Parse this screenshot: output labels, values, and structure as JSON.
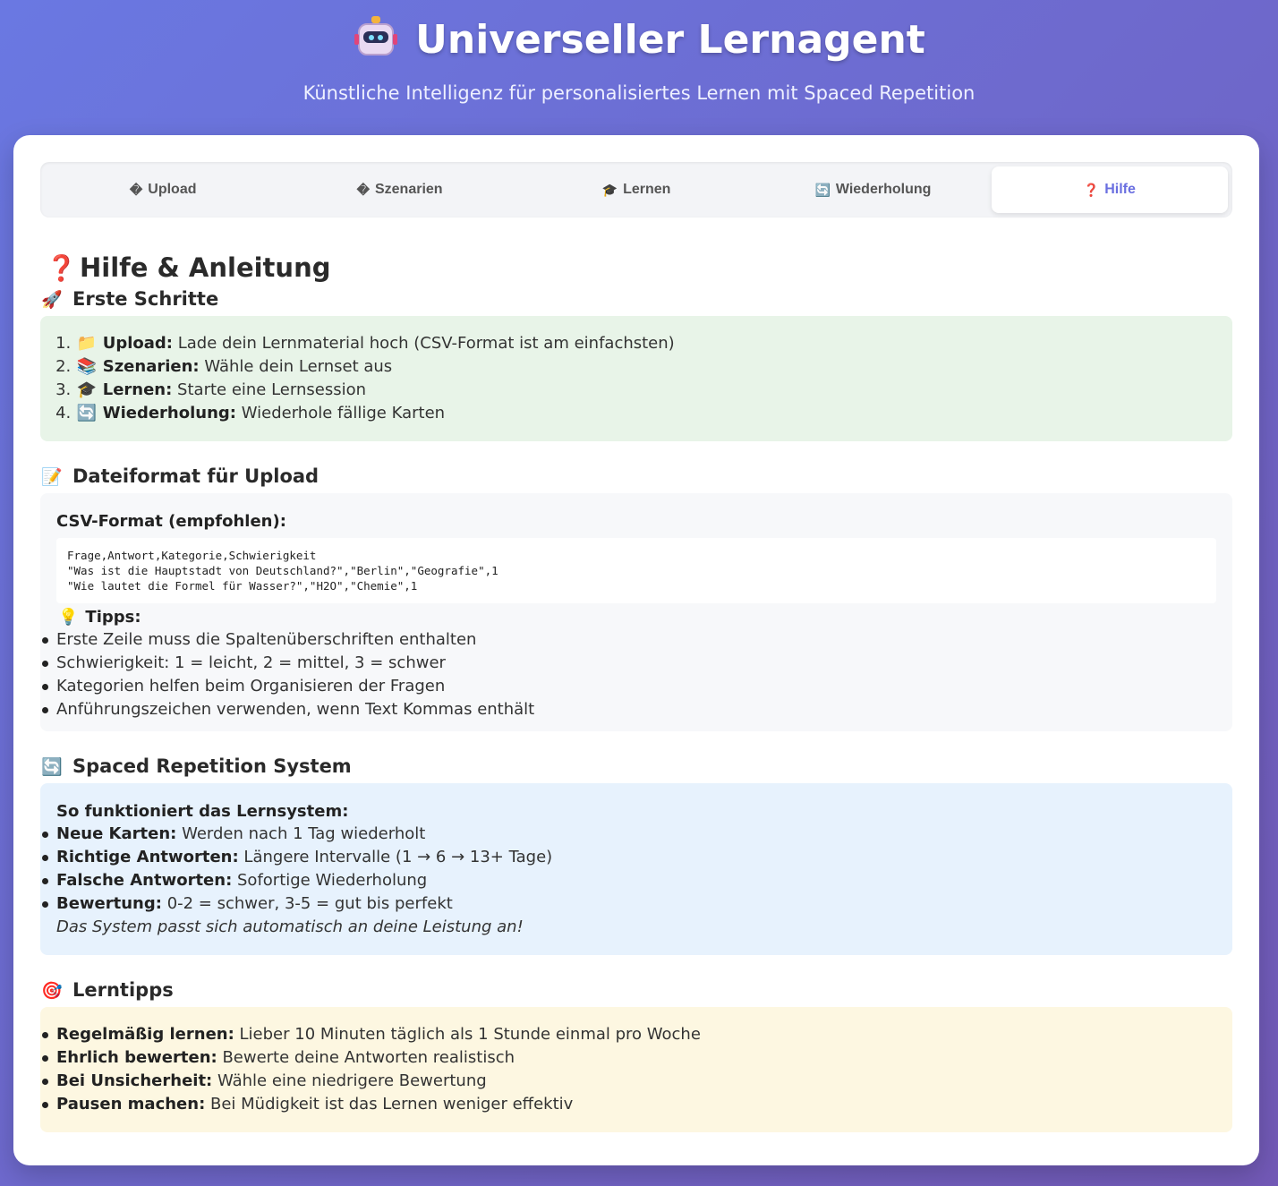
{
  "header": {
    "icon": "robot-icon",
    "title": "Universeller Lernagent",
    "subtitle": "Künstliche Intelligenz für personalisiertes Lernen mit Spaced Repetition"
  },
  "tabs": [
    {
      "icon": "�",
      "label": "Upload",
      "active": false
    },
    {
      "icon": "�",
      "label": "Szenarien",
      "active": false
    },
    {
      "icon": "🎓",
      "label": "Lernen",
      "active": false
    },
    {
      "icon": "🔄",
      "label": "Wiederholung",
      "active": false
    },
    {
      "icon": "❓",
      "label": "Hilfe",
      "active": true
    }
  ],
  "help": {
    "title": "Hilfe & Anleitung",
    "erste_schritte": {
      "heading": "Erste Schritte",
      "steps": [
        {
          "icon": "📁",
          "bold": "Upload:",
          "text": " Lade dein Lernmaterial hoch (CSV-Format ist am einfachsten)"
        },
        {
          "icon": "📚",
          "bold": "Szenarien:",
          "text": " Wähle dein Lernset aus"
        },
        {
          "icon": "🎓",
          "bold": "Lernen:",
          "text": " Starte eine Lernsession"
        },
        {
          "icon": "🔄",
          "bold": "Wiederholung:",
          "text": " Wiederhole fällige Karten"
        }
      ]
    },
    "dateiformat": {
      "heading": "Dateiformat für Upload",
      "csv_label": "CSV-Format (empfohlen):",
      "code": "Frage,Antwort,Kategorie,Schwierigkeit\n\"Was ist die Hauptstadt von Deutschland?\",\"Berlin\",\"Geografie\",1\n\"Wie lautet die Formel für Wasser?\",\"H2O\",\"Chemie\",1",
      "tipps_label": "Tipps:",
      "tipps": [
        "Erste Zeile muss die Spaltenüberschriften enthalten",
        "Schwierigkeit: 1 = leicht, 2 = mittel, 3 = schwer",
        "Kategorien helfen beim Organisieren der Fragen",
        "Anführungszeichen verwenden, wenn Text Kommas enthält"
      ]
    },
    "spaced": {
      "heading": "Spaced Repetition System",
      "intro": "So funktioniert das Lernsystem:",
      "items": [
        {
          "bold": "Neue Karten:",
          "text": " Werden nach 1 Tag wiederholt"
        },
        {
          "bold": "Richtige Antworten:",
          "text": " Längere Intervalle (1 → 6 → 13+ Tage)"
        },
        {
          "bold": "Falsche Antworten:",
          "text": " Sofortige Wiederholung"
        },
        {
          "bold": "Bewertung:",
          "text": " 0-2 = schwer, 3-5 = gut bis perfekt"
        }
      ],
      "note": "Das System passt sich automatisch an deine Leistung an!"
    },
    "lerntipps": {
      "heading": "Lerntipps",
      "items": [
        {
          "bold": "Regelmäßig lernen:",
          "text": " Lieber 10 Minuten täglich als 1 Stunde einmal pro Woche"
        },
        {
          "bold": "Ehrlich bewerten:",
          "text": " Bewerte deine Antworten realistisch"
        },
        {
          "bold": "Bei Unsicherheit:",
          "text": " Wähle eine niedrigere Bewertung"
        },
        {
          "bold": "Pausen machen:",
          "text": " Bei Müdigkeit ist das Lernen weniger effektiv"
        }
      ]
    }
  },
  "colors": {
    "accent": "#6a6fe0",
    "bg_gradient_start": "#6a78e2",
    "bg_gradient_end": "#7259b6"
  }
}
